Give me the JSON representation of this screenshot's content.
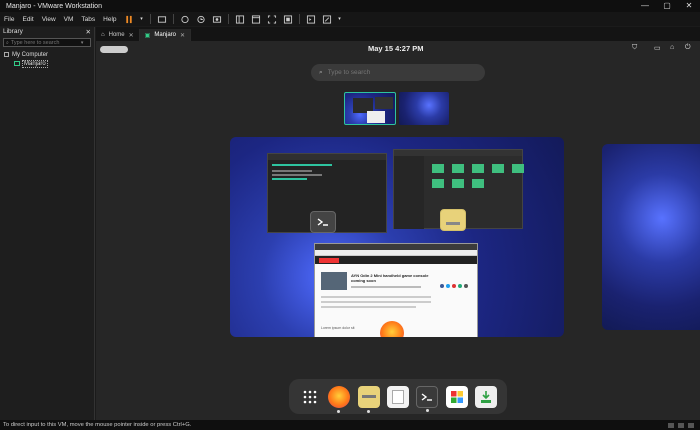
{
  "window": {
    "title": "Manjaro - VMware Workstation"
  },
  "menubar": {
    "items": [
      "File",
      "Edit",
      "View",
      "VM",
      "Tabs",
      "Help"
    ]
  },
  "library": {
    "title": "Library",
    "search_placeholder": "Type here to search",
    "tree": {
      "root": "My Computer",
      "child": "Manjaro"
    }
  },
  "tabs": [
    {
      "label": "Home"
    },
    {
      "label": "Manjaro"
    }
  ],
  "vm": {
    "clock": "May 15     4:27 PM",
    "search_placeholder": "Type to search",
    "windows": {
      "browser_headline": "AYN Odin 2 Mini handheld game console coming soon",
      "browser_headline2": "Lorem ipsum dolor sit"
    },
    "dock": [
      "app-grid",
      "firefox",
      "files",
      "text-editor",
      "terminal",
      "software",
      "installer"
    ]
  },
  "status": {
    "text": "To direct input to this VM, move the mouse pointer inside or press Ctrl+G."
  },
  "colors": {
    "accent": "#2ec4a0",
    "firefox": "#ff7a18",
    "files": "#e8d27a"
  }
}
